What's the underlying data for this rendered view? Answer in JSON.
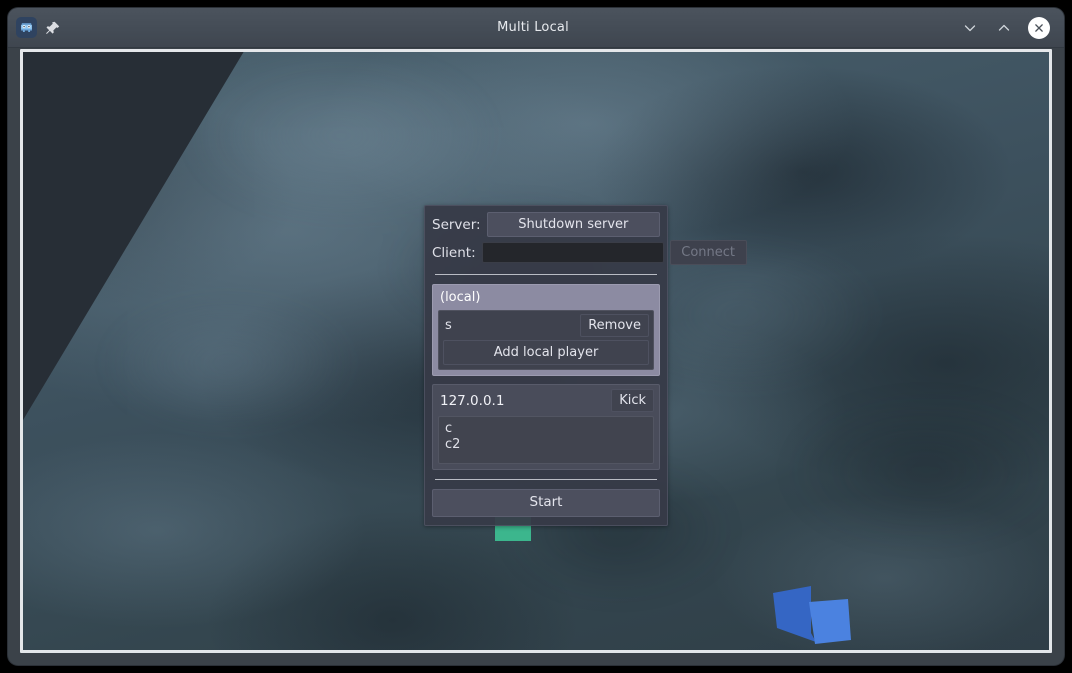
{
  "window": {
    "title": "Multi Local",
    "icons": {
      "app": "godot-app-icon",
      "pin": "pin-icon",
      "minimize": "chevron-down-icon",
      "maximize": "chevron-up-icon",
      "close": "close-icon"
    }
  },
  "lobby": {
    "server_label": "Server:",
    "server_button": "Shutdown server",
    "client_label": "Client:",
    "client_address_value": "",
    "client_address_placeholder": "",
    "connect_button": "Connect",
    "connect_disabled": true,
    "local_group": {
      "title": "(local)",
      "players": [
        {
          "name": "s",
          "remove_label": "Remove"
        }
      ],
      "add_player_button": "Add local player"
    },
    "remote_groups": [
      {
        "address": "127.0.0.1",
        "kick_label": "Kick",
        "players": [
          "c",
          "c2"
        ]
      }
    ],
    "start_button": "Start"
  },
  "scene": {
    "green_cube_color": "#3cb68d",
    "blue_cube_front_color": "#4b82e0",
    "blue_cube_side_color": "#3566c4",
    "ground_color": "#41555f",
    "sky_color": "#272e36"
  },
  "colors": {
    "titlebar": "#444c56",
    "panel_bg": "#373a47",
    "local_group_bg": "#8c8ba2",
    "remote_group_bg": "#494c5a",
    "button_bg": "#4c4f5e",
    "text": "#dcdde6",
    "disabled_text": "#747886",
    "separator": "#b9bcc4"
  }
}
